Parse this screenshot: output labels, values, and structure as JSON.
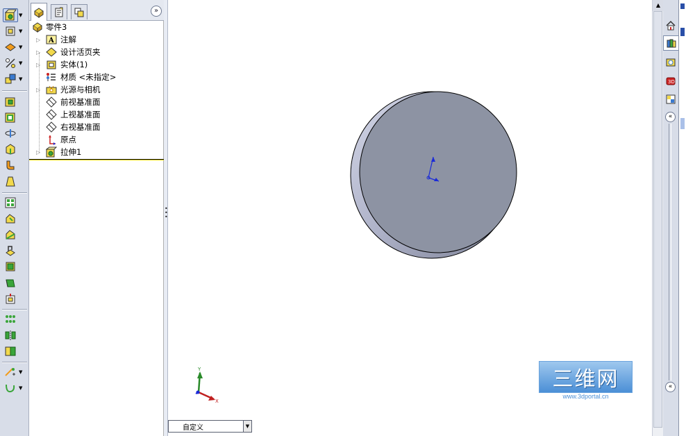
{
  "feature_tree": {
    "root": "零件3",
    "items": [
      {
        "label": "注解",
        "icon": "annotations-icon",
        "expandable": true
      },
      {
        "label": "设计活页夹",
        "icon": "design-binder-icon",
        "expandable": true
      },
      {
        "label": "实体(1)",
        "icon": "solid-bodies-icon",
        "expandable": true
      },
      {
        "label": "材质 <未指定>",
        "icon": "material-icon",
        "expandable": false
      },
      {
        "label": "光源与相机",
        "icon": "lights-cameras-icon",
        "expandable": true
      },
      {
        "label": "前视基准面",
        "icon": "plane-icon",
        "expandable": false
      },
      {
        "label": "上视基准面",
        "icon": "plane-icon",
        "expandable": false
      },
      {
        "label": "右视基准面",
        "icon": "plane-icon",
        "expandable": false
      },
      {
        "label": "原点",
        "icon": "origin-icon",
        "expandable": false
      },
      {
        "label": "拉伸1",
        "icon": "extrude-feature-icon",
        "expandable": true
      }
    ]
  },
  "viewport": {
    "configuration": "自定义",
    "triad": {
      "x_label": "X",
      "y_label": "Y"
    },
    "watermark": {
      "brand": "三维网",
      "url": "www.3dportal.cn"
    }
  },
  "colors": {
    "model_face": "#8d93a3",
    "model_edge": "#c5c9dd",
    "toolbar_bg": "#d8dde8",
    "tree_highlight": "#e6d800"
  }
}
